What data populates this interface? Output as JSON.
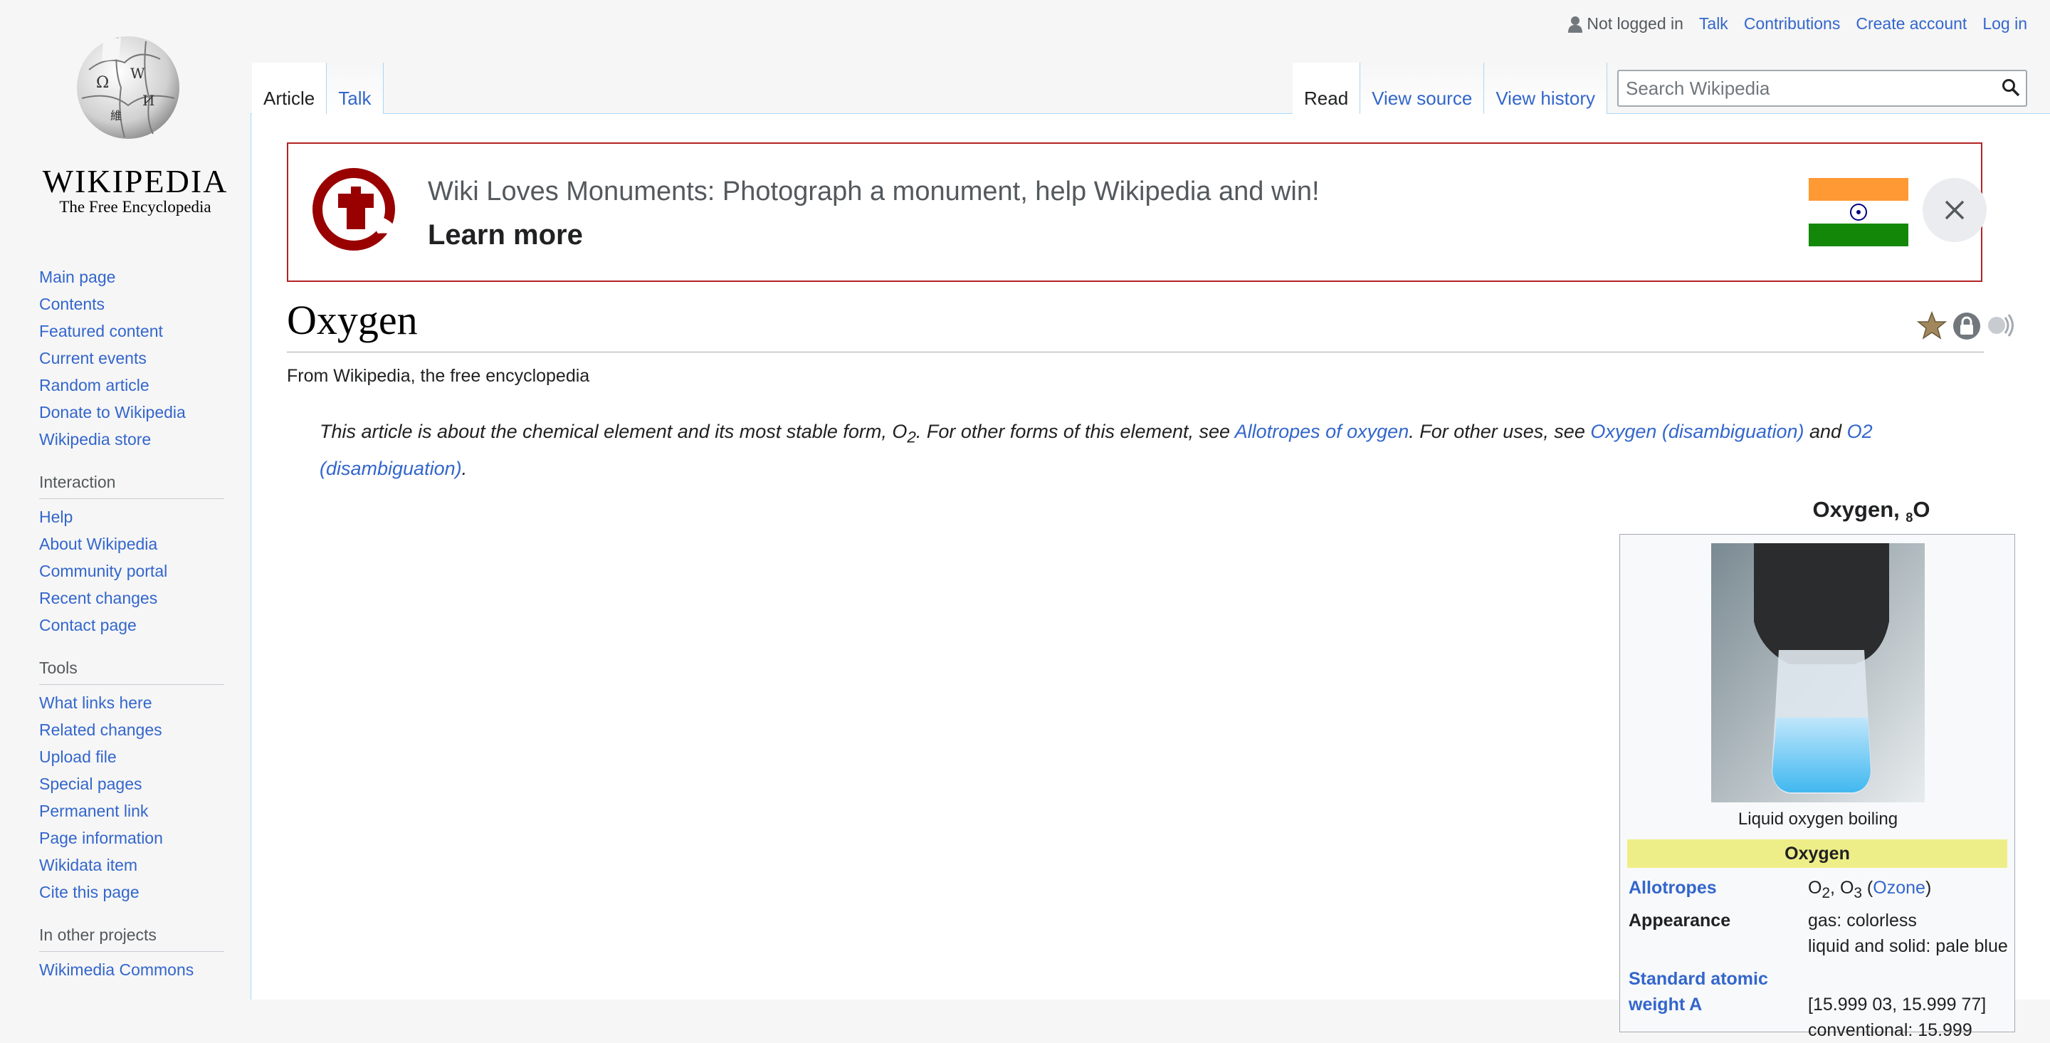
{
  "logo": {
    "wordmark": "Wikipedia",
    "tagline": "The Free Encyclopedia"
  },
  "sidebar": {
    "nav": [
      "Main page",
      "Contents",
      "Featured content",
      "Current events",
      "Random article",
      "Donate to Wikipedia",
      "Wikipedia store"
    ],
    "interaction_heading": "Interaction",
    "interaction": [
      "Help",
      "About Wikipedia",
      "Community portal",
      "Recent changes",
      "Contact page"
    ],
    "tools_heading": "Tools",
    "tools": [
      "What links here",
      "Related changes",
      "Upload file",
      "Special pages",
      "Permanent link",
      "Page information",
      "Wikidata item",
      "Cite this page"
    ],
    "projects_heading": "In other projects",
    "projects": [
      "Wikimedia Commons"
    ]
  },
  "personal": {
    "status": "Not logged in",
    "talk": "Talk",
    "contributions": "Contributions",
    "create_account": "Create account",
    "login": "Log in"
  },
  "tabs": {
    "article": "Article",
    "talk": "Talk",
    "read": "Read",
    "view_source": "View source",
    "view_history": "View history"
  },
  "search": {
    "placeholder": "Search Wikipedia"
  },
  "banner": {
    "title": "Wiki Loves Monuments: Photograph a monument, help Wikipedia and win!",
    "link": "Learn more"
  },
  "article": {
    "title": "Oxygen",
    "subtitle": "From Wikipedia, the free encyclopedia",
    "hatnote": {
      "t1": "This article is about the chemical element and its most stable form, O",
      "sub": "2",
      "t2": ". For other forms of this element, see ",
      "l1": "Allotropes of oxygen",
      "t3": ". For other uses, see ",
      "l2": "Oxygen (disambiguation)",
      "t4": " and ",
      "l3": "O2 (disambiguation)",
      "t5": "."
    }
  },
  "infobox": {
    "caption": "Oxygen, ",
    "caption_sub": "8",
    "caption_sym": "O",
    "image_caption": "Liquid oxygen boiling",
    "header": "Oxygen",
    "rows": {
      "allotropes_label": "Allotropes",
      "allotropes_value_a": "O",
      "allotropes_value_a_sub": "2",
      "allotropes_value_b": ", O",
      "allotropes_value_b_sub": "3",
      "allotropes_value_c": " (",
      "allotropes_link": "Ozone",
      "allotropes_value_d": ")",
      "appearance_label": "Appearance",
      "appearance_value_1": "gas: colorless",
      "appearance_value_2": "liquid and solid: pale blue",
      "weight_label_1": "Standard atomic",
      "weight_label_2": "weight A",
      "weight_value_1": "[15.999 03, 15.999 77]",
      "weight_value_2": "conventional: 15.999"
    }
  },
  "colors": {
    "link": "#3366cc",
    "banner_border": "#b32424",
    "infobox_header": "#eeee88",
    "tab_border": "#a7d7f9"
  }
}
